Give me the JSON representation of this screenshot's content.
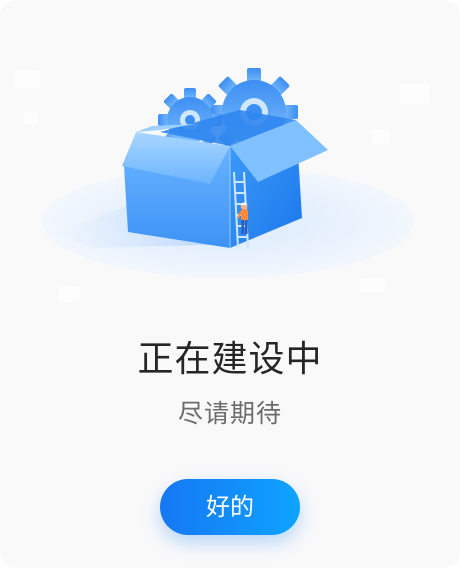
{
  "dialog": {
    "title": "正在建设中",
    "subtitle": "尽请期待",
    "ok_label": "好的"
  },
  "illustration": {
    "icons": [
      "box-icon",
      "gear-icon",
      "ladder-icon",
      "worker-icon"
    ]
  },
  "colors": {
    "background": "#f9f9fa",
    "title": "#262626",
    "subtitle": "#6c6c6c",
    "button_start": "#1677f4",
    "button_end": "#0ea4ff",
    "box_light": "#8ec8ff",
    "box_mid": "#57a8ff",
    "box_dark": "#1e7ff0"
  }
}
